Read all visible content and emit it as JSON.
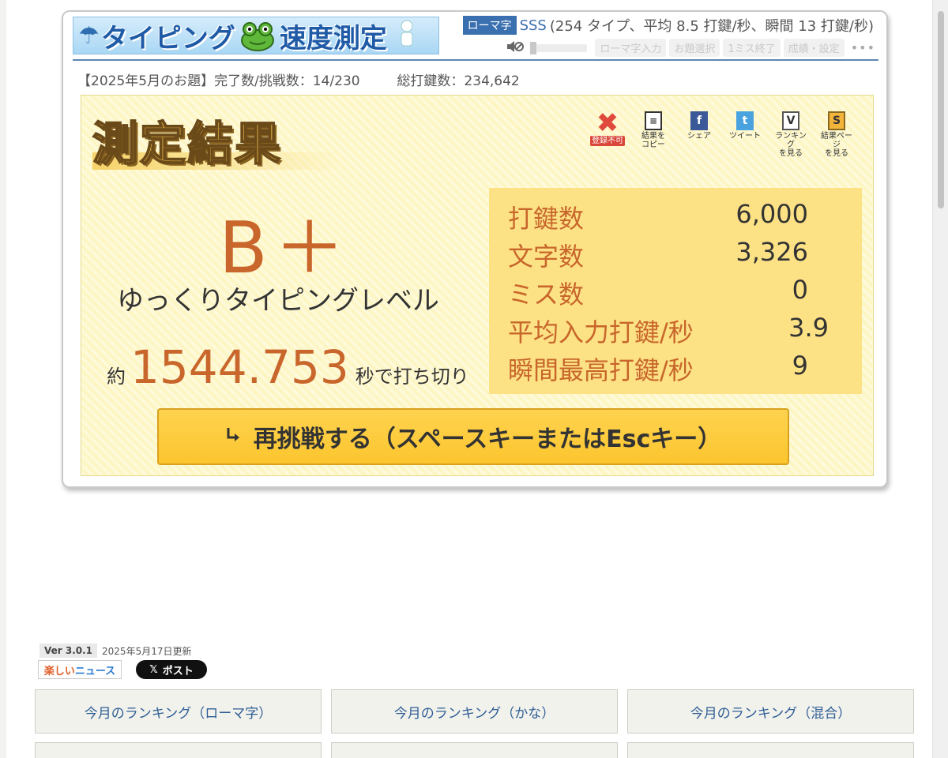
{
  "header": {
    "logo_text_1": "タイピング",
    "logo_text_2": "速度測定",
    "mode_badge": "ローマ字",
    "rank": "SSS",
    "rank_detail": "(254 タイプ、平均 8.5 打鍵/秒、瞬間 13 打鍵/秒)",
    "toolbar": [
      "ローマ字入力",
      "お題選択",
      "1ミス終了",
      "成績・設定"
    ],
    "more": "•••"
  },
  "stats_line": {
    "topic": "【2025年5月のお題】完了数/挑戦数：14/230",
    "total_keys": "総打鍵数：234,642"
  },
  "result": {
    "title": "測定結果",
    "actions": [
      {
        "label": "登録不可",
        "icon": "close-x-icon"
      },
      {
        "label": "結果を\nコピー",
        "icon": "clipboard-icon"
      },
      {
        "label": "シェア",
        "icon": "facebook-icon"
      },
      {
        "label": "ツイート",
        "icon": "twitter-icon"
      },
      {
        "label": "ランキング\nを見る",
        "icon": "ranking-icon"
      },
      {
        "label": "結果ページ\nを見る",
        "icon": "result-page-icon"
      }
    ],
    "grade": "B＋",
    "level": "ゆっくりタイピングレベル",
    "time_prefix": "約",
    "time_value": "1544.753",
    "time_suffix": "秒で打ち切り",
    "stats": [
      {
        "label": "打鍵数",
        "value": "6,000"
      },
      {
        "label": "文字数",
        "value": "3,326"
      },
      {
        "label": "ミス数",
        "value": "0"
      },
      {
        "label": "平均入力打鍵/秒",
        "value": "3.9"
      },
      {
        "label": "瞬間最高打鍵/秒",
        "value": "9"
      }
    ],
    "retry_label": "再挑戦する（スペースキーまたはEscキー）"
  },
  "footer": {
    "version": "Ver 3.0.1",
    "updated": "2025年5月17日更新",
    "news_1": "楽しい",
    "news_2": "ニュース",
    "post_label": "ポスト",
    "nav": [
      "今月のランキング（ローマ字）",
      "今月のランキング（かな）",
      "今月のランキング（混合）",
      "",
      "",
      ""
    ]
  },
  "colors": {
    "accent_blue": "#3a6fb0",
    "grade_orange": "#c8662c",
    "panel_yellow": "#fdf6c4",
    "stats_yellow": "#fde285",
    "button_yellow": "#fbc52e"
  }
}
